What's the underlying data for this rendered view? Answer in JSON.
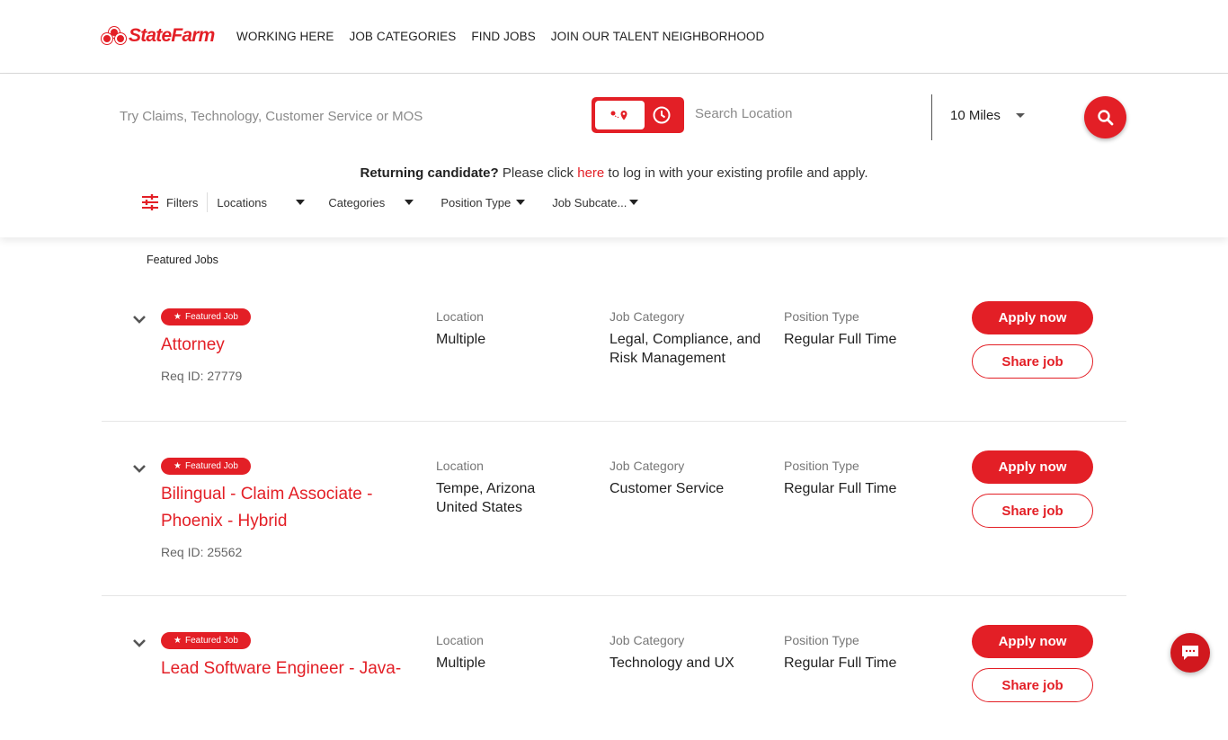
{
  "brand": {
    "name": "StateFarm",
    "accent": "#e31f26"
  },
  "nav": {
    "items": [
      "WORKING HERE",
      "JOB CATEGORIES",
      "FIND JOBS",
      "JOIN OUR TALENT NEIGHBORHOOD"
    ]
  },
  "search": {
    "keyword_placeholder": "Try Claims, Technology, Customer Service or MOS",
    "location_placeholder": "Search Location",
    "distance": "10 Miles",
    "toggle_icons": [
      "route-pin-icon",
      "clock-icon"
    ]
  },
  "returning": {
    "bold": "Returning candidate?",
    "pre": " Please click ",
    "link": "here",
    "post": " to log in with your existing profile and apply."
  },
  "filters": {
    "label": "Filters",
    "dropdowns": [
      "Locations",
      "Categories",
      "Position Type",
      "Job Subcate..."
    ]
  },
  "featured_label": "Featured Jobs",
  "jobs": [
    {
      "badge": "Featured Job",
      "title": "Attorney",
      "req": "Req ID: 27779",
      "location_label": "Location",
      "location": "Multiple",
      "category_label": "Job Category",
      "category": "Legal, Compliance, and Risk Management",
      "type_label": "Position Type",
      "type": "Regular Full Time",
      "apply": "Apply now",
      "share": "Share job"
    },
    {
      "badge": "Featured Job",
      "title": "Bilingual - Claim Associate - Phoenix - Hybrid",
      "req": "Req ID: 25562",
      "location_label": "Location",
      "location": "Tempe, Arizona United States",
      "category_label": "Job Category",
      "category": "Customer Service",
      "type_label": "Position Type",
      "type": "Regular Full Time",
      "apply": "Apply now",
      "share": "Share job"
    },
    {
      "badge": "Featured Job",
      "title": "Lead Software Engineer - Java-",
      "req": "",
      "location_label": "Location",
      "location": "Multiple",
      "category_label": "Job Category",
      "category": "Technology and UX",
      "type_label": "Position Type",
      "type": "Regular Full Time",
      "apply": "Apply now",
      "share": "Share job"
    }
  ]
}
